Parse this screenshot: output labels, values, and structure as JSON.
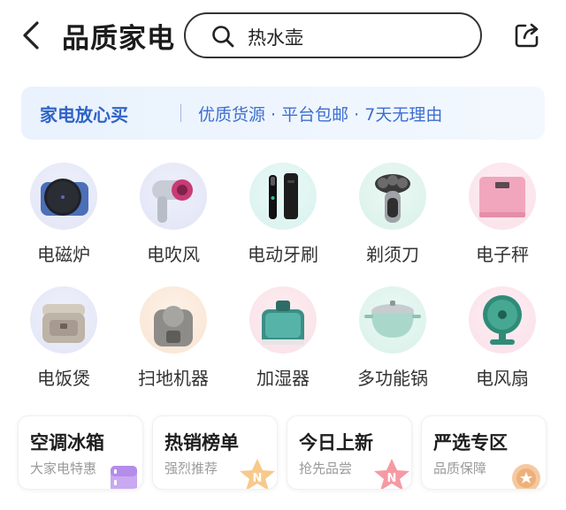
{
  "header": {
    "title": "品质家电",
    "search_value": "热水壶"
  },
  "banner": {
    "main": "家电放心买",
    "sub": "优质货源 · 平台包邮 · 7天无理由"
  },
  "categories": [
    {
      "label": "电磁炉",
      "icon": "induction-cooker-image"
    },
    {
      "label": "电吹风",
      "icon": "hair-dryer-image"
    },
    {
      "label": "电动牙刷",
      "icon": "electric-toothbrush-image"
    },
    {
      "label": "剃须刀",
      "icon": "shaver-image"
    },
    {
      "label": "电子秤",
      "icon": "scale-image"
    },
    {
      "label": "电饭煲",
      "icon": "rice-cooker-image"
    },
    {
      "label": "扫地机器",
      "icon": "robot-vacuum-image"
    },
    {
      "label": "加湿器",
      "icon": "humidifier-image"
    },
    {
      "label": "多功能锅",
      "icon": "multi-pot-image"
    },
    {
      "label": "电风扇",
      "icon": "fan-image"
    }
  ],
  "cards": [
    {
      "title": "空调冰箱",
      "subtitle": "大家电特惠",
      "icon": "fridge-icon"
    },
    {
      "title": "热销榜单",
      "subtitle": "强烈推荐",
      "icon": "hot-star-icon"
    },
    {
      "title": "今日上新",
      "subtitle": "抢先品尝",
      "icon": "new-star-icon"
    },
    {
      "title": "严选专区",
      "subtitle": "品质保障",
      "icon": "medal-icon"
    }
  ],
  "colors": {
    "accent_blue": "#2f63c7",
    "banner_bg": "#e9f2fd",
    "text_dark": "#1b1b1b"
  }
}
